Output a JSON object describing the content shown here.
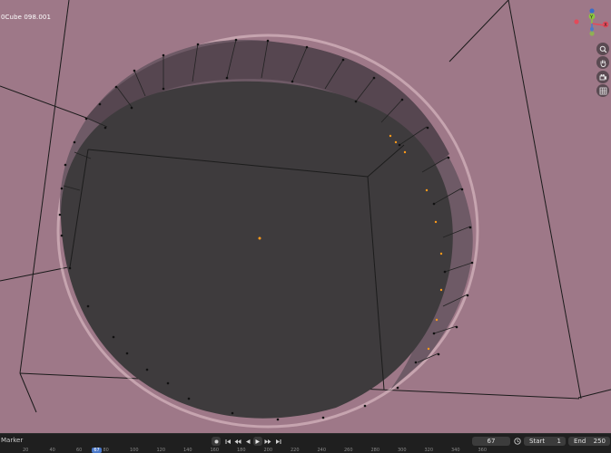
{
  "viewport": {
    "object_name": "0Cube 098.001",
    "nav": {
      "gizmo_icon": "axis-gizmo-icon",
      "zoom_icon": "zoom-icon",
      "pan_icon": "hand-icon",
      "camera_icon": "camera-icon",
      "grid_icon": "grid-icon"
    },
    "axis_labels": {
      "y": "Y",
      "x": "X",
      "z": "Z"
    }
  },
  "timeline": {
    "marker_label": "Marker",
    "current_frame": "67",
    "start_label": "Start",
    "start_value": "1",
    "end_label": "End",
    "end_value": "250",
    "ruler_ticks": [
      "20",
      "40",
      "60",
      "80",
      "100",
      "120",
      "140",
      "160",
      "180",
      "200",
      "220",
      "240",
      "260",
      "280",
      "300",
      "320",
      "340",
      "360"
    ],
    "ruler_current": "67"
  },
  "colors": {
    "viewport_bg": "#9e7888",
    "cap_face": "#3e3b3d",
    "side_band": "#6a5862",
    "selection": "#ff9a1a",
    "timeline_bg": "#1f1f1f"
  }
}
